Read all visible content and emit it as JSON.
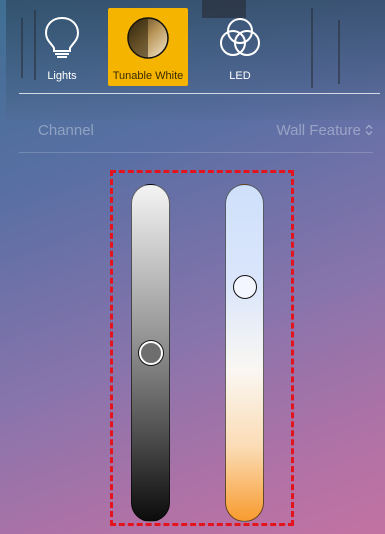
{
  "tabs": [
    {
      "label": "Lights",
      "icon": "lightbulb-icon",
      "active": false
    },
    {
      "label": "Tunable White",
      "icon": "tunable-white-icon",
      "active": true
    },
    {
      "label": "LED",
      "icon": "rgb-circles-icon",
      "active": false
    }
  ],
  "channel": {
    "label": "Channel",
    "value": "Wall Feature",
    "value_icon": "stepper-icon"
  },
  "sliders": {
    "brightness": {
      "level": 0.5,
      "track_colors": [
        "#f4f4f4",
        "#0b0b0b"
      ]
    },
    "color_temperature": {
      "level": 0.72,
      "track_colors": [
        "#cfe0fb",
        "#f89b2f"
      ]
    }
  },
  "colors": {
    "accent": "#f4b400",
    "selection_outline": "#e4141e"
  }
}
